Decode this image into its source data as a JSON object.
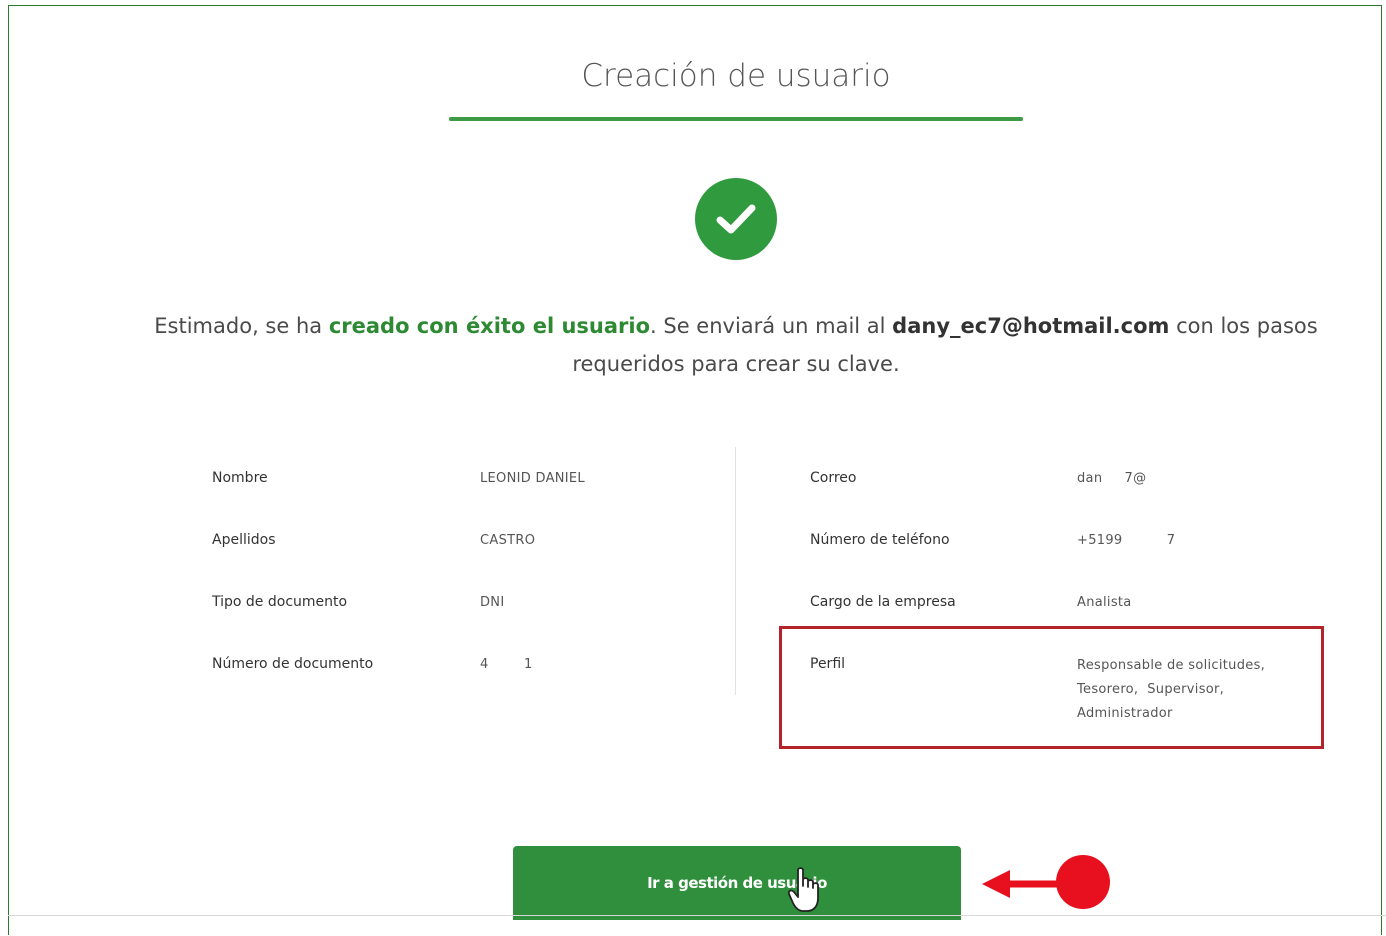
{
  "header": {
    "title": "Creación de usuario"
  },
  "message": {
    "part1": "Estimado, se ha ",
    "highlight": "creado con éxito el usuario",
    "part2": ". Se enviará un mail al ",
    "email": "dany_ec7@hotmail.com",
    "part3": " con los pasos requeridos para crear su clave."
  },
  "details_left": [
    {
      "label": "Nombre",
      "value": "LEONID DANIEL"
    },
    {
      "label": "Apellidos",
      "value": "CASTRO"
    },
    {
      "label": "Tipo de documento",
      "value": "DNI"
    },
    {
      "label": "Número de documento",
      "value": "4        1"
    }
  ],
  "details_right": [
    {
      "label": "Correo",
      "value": "dan     7@"
    },
    {
      "label": "Número de teléfono",
      "value": "+5199          7"
    },
    {
      "label": "Cargo de la empresa",
      "value": "Analista"
    },
    {
      "label": "Perfil",
      "value_lines": [
        "Responsable de solicitudes,",
        "Tesorero,  Supervisor,",
        "Administrador"
      ]
    }
  ],
  "action": {
    "button_label": "Ir a gestión de usuario"
  },
  "icons": {
    "success": "check-icon",
    "cursor": "hand-cursor-icon",
    "annotation": "arrow-left-annotation-icon"
  },
  "colors": {
    "accent": "#2f8f3c",
    "highlight_box": "#b3242a",
    "annotation": "#e8101e"
  }
}
